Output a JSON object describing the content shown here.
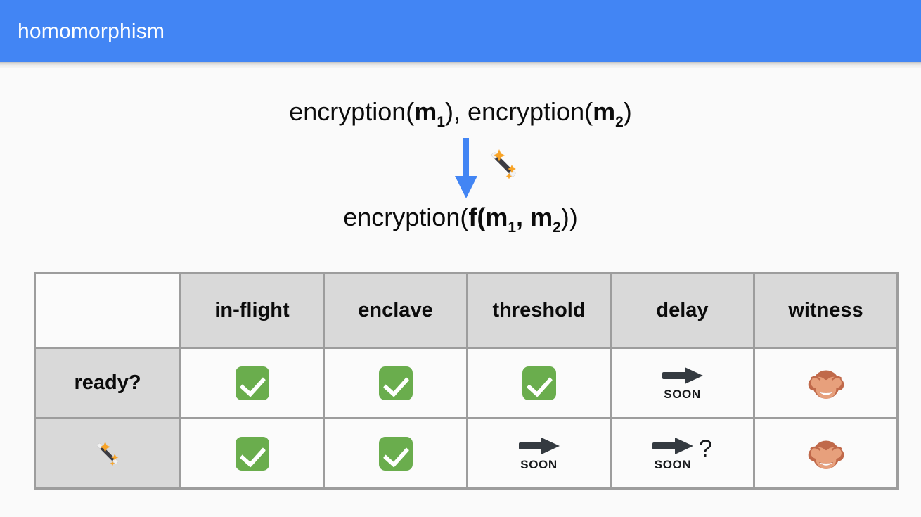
{
  "header": {
    "title": "homomorphism",
    "bg_color": "#4285f4",
    "text_color": "#ffffff"
  },
  "diagram": {
    "input_label": "encryption(m1), encryption(m2)",
    "input_parts": {
      "prefix1": "encryption(",
      "m1": "m",
      "sub1": "1",
      "middle": "), encryption(",
      "m2": "m",
      "sub2": "2",
      "suffix": ")"
    },
    "arrow_icon": "down-arrow-icon",
    "arrow_color": "#4285f4",
    "wand_icon": "magic-wand-icon",
    "output_label": "encryption(f(m1, m2))",
    "output_parts": {
      "prefix": "encryption(",
      "f": "f",
      "open": "(",
      "m1": "m",
      "sub1": "1",
      "comma": ", ",
      "m2": "m",
      "sub2": "2",
      "suffix": "))"
    }
  },
  "table": {
    "corner_label": "",
    "columns": [
      "in-flight",
      "enclave",
      "threshold",
      "delay",
      "witness"
    ],
    "rows": [
      {
        "label": "ready?",
        "label_kind": "text",
        "cells": [
          {
            "kind": "check",
            "icon": "check-mark-icon"
          },
          {
            "kind": "check",
            "icon": "check-mark-icon"
          },
          {
            "kind": "check",
            "icon": "check-mark-icon"
          },
          {
            "kind": "soon",
            "icon": "soon-arrow-icon",
            "text": "SOON"
          },
          {
            "kind": "monkey",
            "icon": "see-no-evil-monkey-icon"
          }
        ]
      },
      {
        "label": "",
        "label_kind": "wand",
        "label_icon": "magic-wand-icon",
        "cells": [
          {
            "kind": "check",
            "icon": "check-mark-icon"
          },
          {
            "kind": "check",
            "icon": "check-mark-icon"
          },
          {
            "kind": "soon",
            "icon": "soon-arrow-icon",
            "text": "SOON"
          },
          {
            "kind": "soon-question",
            "icon": "soon-arrow-icon",
            "text": "SOON",
            "question": "?"
          },
          {
            "kind": "monkey",
            "icon": "see-no-evil-monkey-icon"
          }
        ]
      }
    ],
    "colors": {
      "header_bg": "#d9d9d9",
      "cell_bg": "#fbfbfb",
      "border": "#9d9d9d",
      "check_green": "#6aad4d",
      "arrow_dark": "#343a40"
    }
  }
}
